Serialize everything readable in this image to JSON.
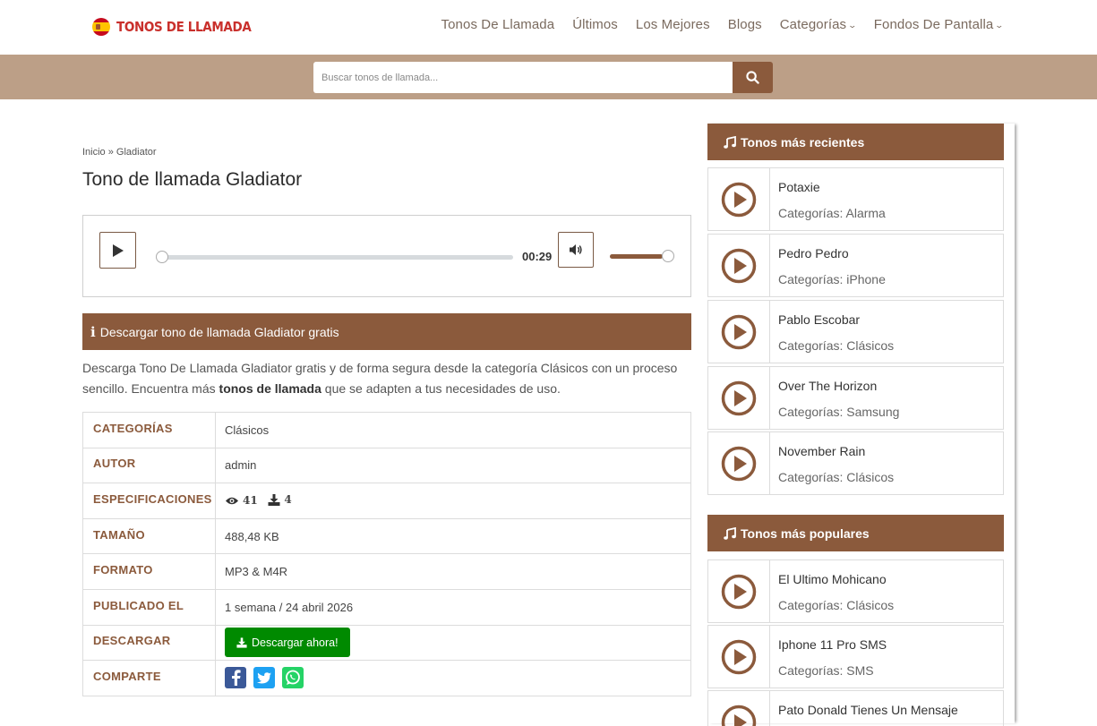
{
  "header": {
    "logo_text": "TONOS DE LLAMADA",
    "nav": [
      {
        "label": "Tonos De Llamada",
        "dropdown": false
      },
      {
        "label": "Últimos",
        "dropdown": false
      },
      {
        "label": "Los Mejores",
        "dropdown": false
      },
      {
        "label": "Blogs",
        "dropdown": false
      },
      {
        "label": "Categorías",
        "dropdown": true
      },
      {
        "label": "Fondos De Pantalla",
        "dropdown": true
      }
    ]
  },
  "search": {
    "placeholder": "Buscar tonos de llamada..."
  },
  "breadcrumb": "Inicio » Gladiator",
  "title": "Tono de llamada Gladiator",
  "player": {
    "time": "00:29",
    "progress": 0,
    "volume": 0.9
  },
  "download_section": {
    "heading": "Descargar tono de llamada Gladiator gratis",
    "desc_before": "Descarga Tono De Llamada Gladiator gratis y de forma segura desde la categoría Clásicos con un proceso sencillo. Encuentra más ",
    "desc_link": "tonos de llamada",
    "desc_after": " que se adapten a tus necesidades de uso."
  },
  "table": {
    "categorias_label": "CATEGORÍAS",
    "categorias_value": "Clásicos",
    "autor_label": "AUTOR",
    "autor_value": "admin",
    "specs_label": "ESPECIFICACIONES",
    "views": "41",
    "downloads": "4",
    "tamano_label": "TAMAÑO",
    "tamano_value": "488,48 KB",
    "formato_label": "FORMATO",
    "formato_value": "MP3 & M4R",
    "publicado_label": "PUBLICADO EL",
    "publicado_value": "1 semana / 24 abril 2026",
    "descargar_label": "DESCARGAR",
    "descargar_button": "Descargar ahora!",
    "comparte_label": "COMPARTE"
  },
  "sidebar": {
    "recent_title": "Tonos más recientes",
    "recent": [
      {
        "title": "Potaxie",
        "category": "Categorías: Alarma"
      },
      {
        "title": "Pedro Pedro",
        "category": "Categorías: iPhone"
      },
      {
        "title": "Pablo Escobar",
        "category": "Categorías: Clásicos"
      },
      {
        "title": "Over The Horizon",
        "category": "Categorías: Samsung"
      },
      {
        "title": "November Rain",
        "category": "Categorías: Clásicos"
      }
    ],
    "popular_title": "Tonos más populares",
    "popular": [
      {
        "title": "El Ultimo Mohicano",
        "category": "Categorías: Clásicos"
      },
      {
        "title": "Iphone 11 Pro SMS",
        "category": "Categorías: SMS"
      },
      {
        "title": "Pato Donald Tienes Un Mensaje",
        "category": ""
      }
    ]
  },
  "colors": {
    "brand": "#8b5a3c",
    "search_bar": "#bc9f87",
    "download_green": "#008a00",
    "logo_red": "#c9302c"
  }
}
